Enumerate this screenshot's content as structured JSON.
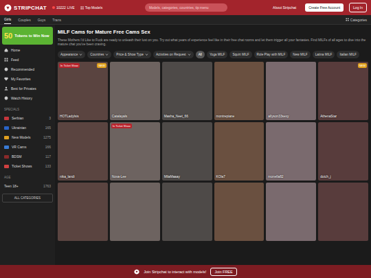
{
  "header": {
    "logo": "STRIPCHAT",
    "live_count": "10222",
    "live_label": "LIVE",
    "top_models": "Top Models",
    "search": {
      "placeholder": "Models, categories, countries, tip menu"
    },
    "about": "About Stripchat",
    "create_account": "Create Free Account",
    "login": "Log In"
  },
  "tabs": [
    {
      "label": "Girls",
      "selected": true
    },
    {
      "label": "Couples",
      "selected": false
    },
    {
      "label": "Guys",
      "selected": false
    },
    {
      "label": "Trans",
      "selected": false
    }
  ],
  "categories_button": "Categories",
  "promo": {
    "amount": "50",
    "text": "Tokens to Win Now"
  },
  "sidebar": {
    "items": [
      {
        "label": "Home",
        "selected": false
      },
      {
        "label": "Feed",
        "selected": false
      },
      {
        "label": "Recommended",
        "selected": false
      },
      {
        "label": "My Favorites",
        "selected": false
      },
      {
        "label": "Best for Privates",
        "selected": false
      },
      {
        "label": "Watch History",
        "selected": false
      }
    ],
    "specials_heading": "SPECIALS",
    "specials": [
      {
        "label": "Serbian",
        "count": "3",
        "color": "#c6363c"
      },
      {
        "label": "Ukrainian",
        "count": "165",
        "color": "#2a64c8"
      },
      {
        "label": "New Models",
        "count": "1275",
        "color": "#e0a020"
      },
      {
        "label": "VR Cams",
        "count": "166",
        "color": "#3a7bd5"
      },
      {
        "label": "BDSM",
        "count": "117",
        "color": "#8a2a2a"
      },
      {
        "label": "Ticket Shows",
        "count": "133",
        "color": "#d04040"
      }
    ],
    "age_heading": "AGE",
    "age": [
      {
        "label": "Teen 18+",
        "count": "1763"
      }
    ],
    "all_categories": "ALL CATEGORIES"
  },
  "page": {
    "title": "MILF Cams for Mature Free Cams Sex",
    "description": "These Mothers I'd Like to Fuck are ready to unleash their lust on you. Try out what years of experience feel like in their free chat rooms and let them trigger all your fantasies. Find MILFs of all ages to dive into the mature chat you've been craving."
  },
  "filters": [
    "Appearance",
    "Countries",
    "Price & Show Type",
    "Activities on Request"
  ],
  "tags": [
    {
      "label": "All",
      "selected": true
    },
    {
      "label": "Yoga MILF",
      "selected": false
    },
    {
      "label": "Squirt MILF",
      "selected": false
    },
    {
      "label": "Role Play with MILF",
      "selected": false
    },
    {
      "label": "New MILF",
      "selected": false
    },
    {
      "label": "Latina MILF",
      "selected": false
    },
    {
      "label": "Italian MILF",
      "selected": false
    }
  ],
  "models": [
    {
      "name": "HOTLadyIsis",
      "badges": [
        {
          "text": "In Ticket Show",
          "kind": "ticket"
        },
        {
          "text": "NEW",
          "kind": "new"
        }
      ]
    },
    {
      "name": "Catalayals",
      "badges": []
    },
    {
      "name": "Masha_Neet_66",
      "badges": []
    },
    {
      "name": "montrepiane",
      "badges": []
    },
    {
      "name": "allyson33sexy",
      "badges": []
    },
    {
      "name": "AthenaStar",
      "badges": [
        {
          "text": "NEW",
          "kind": "new"
        }
      ]
    },
    {
      "name": "nika_landi",
      "badges": []
    },
    {
      "name": "Nova-Lee",
      "badges": [
        {
          "text": "In Ticket Show",
          "kind": "ticket"
        }
      ]
    },
    {
      "name": "MilaMaaay",
      "badges": []
    },
    {
      "name": "KOla7",
      "badges": []
    },
    {
      "name": "monella82",
      "badges": []
    },
    {
      "name": "dutch_j",
      "badges": []
    },
    {
      "badges": []
    },
    {
      "badges": []
    },
    {
      "badges": []
    },
    {
      "badges": []
    },
    {
      "badges": []
    },
    {
      "badges": []
    }
  ],
  "banner": {
    "text": "Join Stripchat to interact with models!",
    "button": "Join FREE"
  }
}
